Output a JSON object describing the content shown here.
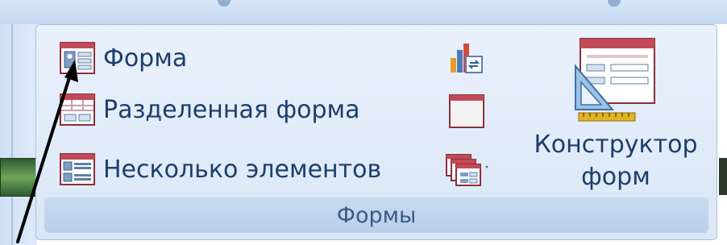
{
  "ribbon": {
    "group_label": "Формы",
    "commands": {
      "form_label": "Форма",
      "split_form_label": "Разделенная форма",
      "multiple_items_label": "Несколько элементов"
    },
    "designer": {
      "label_line1": "Конструктор",
      "label_line2": "форм"
    }
  },
  "icons": {
    "form": "form-icon",
    "split_form": "split-form-icon",
    "multiple_items": "multiple-items-icon",
    "pivot_chart": "pivot-chart-icon",
    "blank_form": "blank-form-icon",
    "more_forms": "more-forms-icon",
    "form_design": "form-design-icon"
  },
  "colors": {
    "label_text": "#1c3e6b",
    "group_label": "#3c5a86",
    "ribbon_background": "#e3ecf8",
    "arrow": "#000000"
  }
}
